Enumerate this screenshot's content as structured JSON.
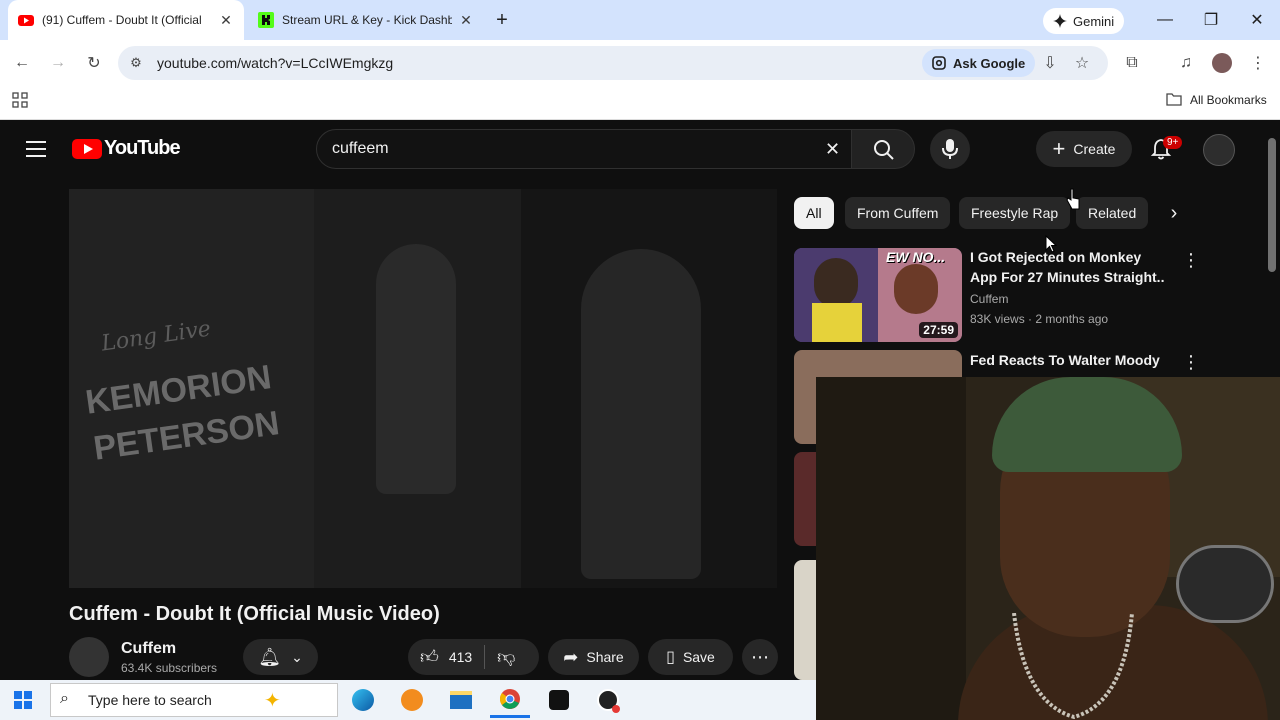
{
  "browser": {
    "tabs": [
      {
        "title": "(91) Cuffem - Doubt It (Official",
        "favicon": "youtube-icon",
        "active": true
      },
      {
        "title": "Stream URL & Key - Kick Dashb",
        "favicon": "kick-icon",
        "active": false
      }
    ],
    "gemini_label": "Gemini",
    "url": "youtube.com/watch?v=LCcIWEmgkzg",
    "ask_google_label": "Ask Google",
    "all_bookmarks_label": "All Bookmarks"
  },
  "youtube": {
    "logo_text": "YouTube",
    "search_value": "cuffeem",
    "create_label": "Create",
    "notifications_badge": "9+",
    "video": {
      "title": "Cuffem - Doubt It (Official Music Video)",
      "channel": "Cuffem",
      "subscribers": "63.4K subscribers",
      "likes": "413",
      "share_label": "Share",
      "save_label": "Save"
    },
    "thumbnail_text": {
      "line1": "Long Live",
      "line2": "KEMORION",
      "line3": "PETERSON"
    },
    "chips": [
      "All",
      "From Cuffem",
      "Freestyle Rap",
      "Related"
    ],
    "recommendations": [
      {
        "title": "I Got Rejected on Monkey App For 27 Minutes Straight..",
        "channel": "Cuffem",
        "meta": "83K views · 2 months ago",
        "duration": "27:59",
        "thumb_label": "EW NO..."
      },
      {
        "title": "Fed Reacts To Walter Moody",
        "channel": "",
        "meta": "",
        "duration": ""
      }
    ]
  },
  "taskbar": {
    "search_placeholder": "Type here to search"
  },
  "colors": {
    "tabstrip_bg": "#d3e3fd",
    "youtube_red": "#ff0000",
    "yt_bg": "#0f0f0f",
    "badge_red": "#cc0000"
  }
}
